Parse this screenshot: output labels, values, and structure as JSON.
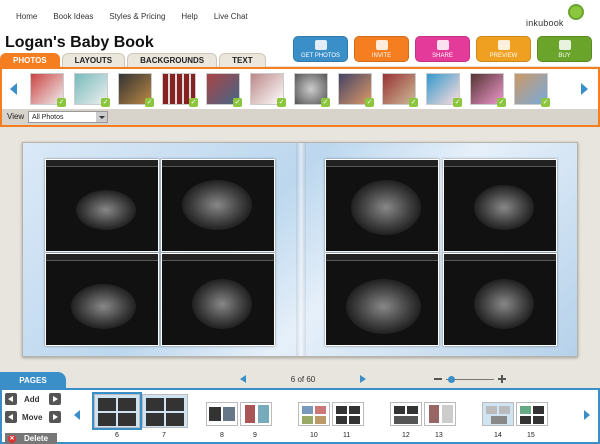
{
  "nav": {
    "links": [
      "Home",
      "Book Ideas",
      "Styles & Pricing",
      "Help",
      "Live Chat"
    ],
    "logo": "inkubook"
  },
  "header": {
    "title": "Logan's Baby Book"
  },
  "tabs": [
    "PHOTOS",
    "LAYOUTS",
    "BACKGROUNDS",
    "TEXT"
  ],
  "actions": [
    {
      "label": "GET PHOTOS",
      "color": "#3a8fc8",
      "icon": "camera-icon"
    },
    {
      "label": "INVITE",
      "color": "#f57f20",
      "icon": "invite-icon"
    },
    {
      "label": "SHARE",
      "color": "#e43a9a",
      "icon": "share-icon"
    },
    {
      "label": "PREVIEW",
      "color": "#f0a020",
      "icon": "book-icon"
    },
    {
      "label": "BUY",
      "color": "#6aa42a",
      "icon": "cart-icon"
    }
  ],
  "photo_strip": {
    "view_label": "View",
    "view_selected": "All Photos"
  },
  "pages": {
    "tab_label": "PAGES",
    "page_indicator": "6 of 60",
    "add_label": "Add",
    "move_label": "Move",
    "delete_label": "Delete",
    "page_numbers": [
      "6",
      "7",
      "8",
      "9",
      "10",
      "11",
      "12",
      "13",
      "14",
      "15"
    ]
  },
  "colors": {
    "accent_orange": "#f57f20",
    "accent_blue": "#3a8fc8"
  }
}
